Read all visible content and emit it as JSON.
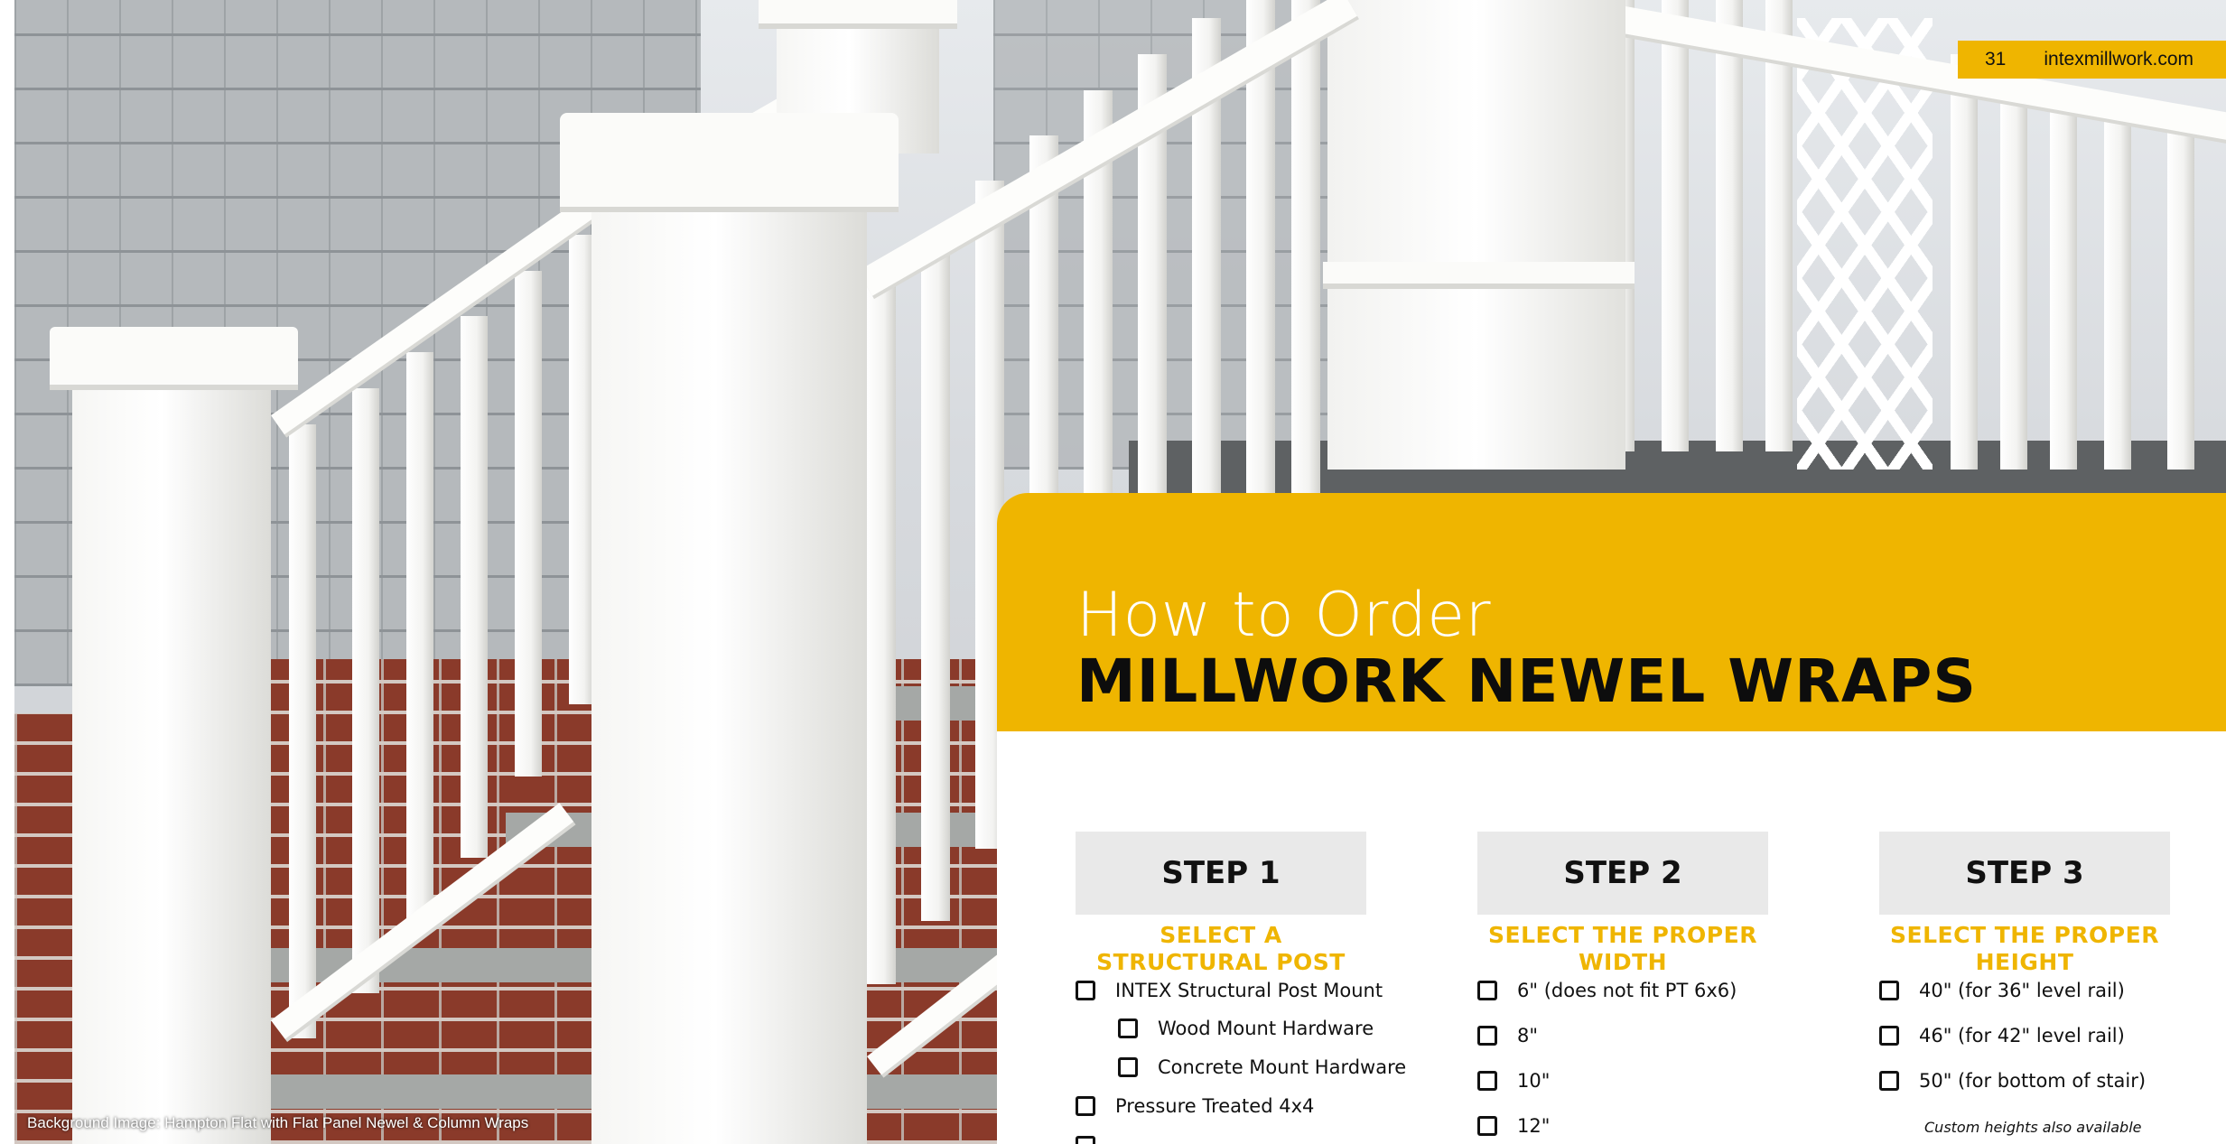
{
  "page": {
    "number": "31",
    "website": "intexmillwork.com",
    "photo_caption": "Background Image: Hampton Flat with Flat Panel Newel & Column Wraps",
    "accent_color": "#efb500"
  },
  "header": {
    "title_light": "How to Order",
    "title_bold": "MILLWORK NEWEL WRAPS"
  },
  "steps": [
    {
      "label": "STEP 1",
      "subtitle": "SELECT A STRUCTURAL POST",
      "options": [
        "INTEX Structural Post Mount",
        "Wood Mount Hardware",
        "Concrete Mount Hardware",
        "Pressure Treated 4x4"
      ]
    },
    {
      "label": "STEP 2",
      "subtitle": "SELECT THE PROPER WIDTH",
      "options": [
        "6\" (does not fit PT 6x6)",
        "8\"",
        "10\"",
        "12\""
      ]
    },
    {
      "label": "STEP 3",
      "subtitle": "SELECT THE PROPER HEIGHT",
      "options": [
        "40\" (for 36\" level rail)",
        "46\" (for 42\" level rail)",
        "50\" (for bottom of stair)"
      ],
      "note": "Custom heights also available"
    }
  ]
}
